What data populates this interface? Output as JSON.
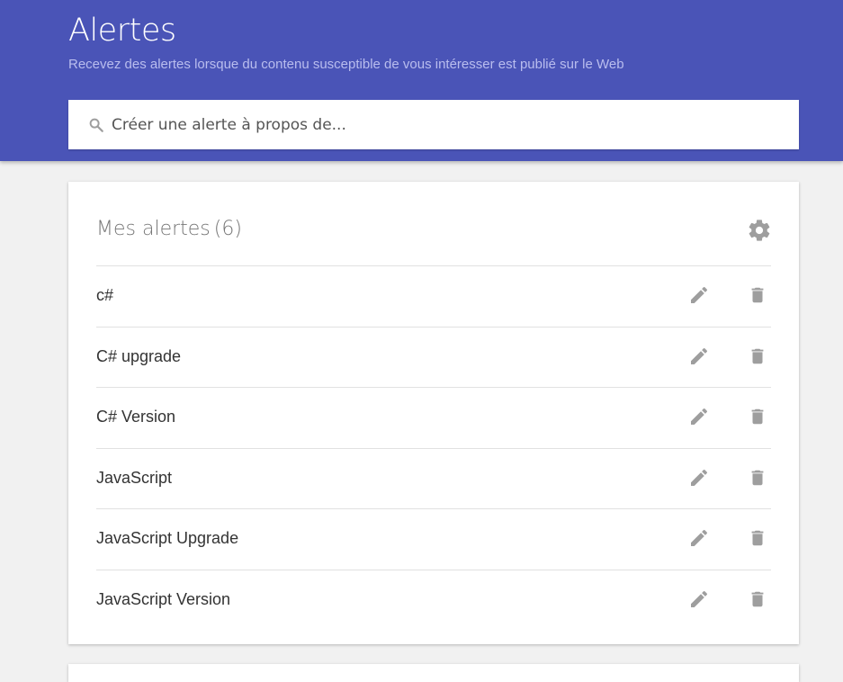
{
  "header": {
    "title": "Alertes",
    "subtitle": "Recevez des alertes lorsque du contenu susceptible de vous intéresser est publié sur le Web",
    "background_color": "#4a54b7"
  },
  "search": {
    "placeholder": "Créer une alerte à propos de...",
    "value": "",
    "icon": "search-icon"
  },
  "alerts": {
    "title": "Mes alertes",
    "count": "(6)",
    "settings_icon": "gear-icon",
    "items": [
      {
        "label": "c#",
        "edit_icon": "pencil-icon",
        "delete_icon": "trash-icon"
      },
      {
        "label": "C# upgrade",
        "edit_icon": "pencil-icon",
        "delete_icon": "trash-icon"
      },
      {
        "label": "C# Version",
        "edit_icon": "pencil-icon",
        "delete_icon": "trash-icon"
      },
      {
        "label": "JavaScript",
        "edit_icon": "pencil-icon",
        "delete_icon": "trash-icon"
      },
      {
        "label": "JavaScript Upgrade",
        "edit_icon": "pencil-icon",
        "delete_icon": "trash-icon"
      },
      {
        "label": "JavaScript Version",
        "edit_icon": "pencil-icon",
        "delete_icon": "trash-icon"
      }
    ]
  },
  "colors": {
    "accent": "#4a54b7",
    "icon_gray": "#9e9e9e",
    "background": "#f1f1f1"
  }
}
